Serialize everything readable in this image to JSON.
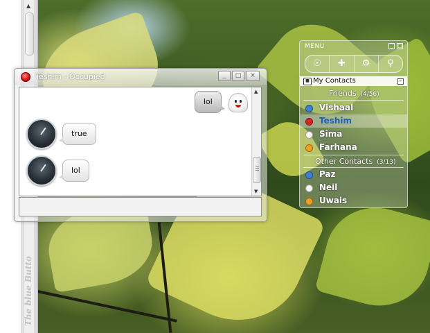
{
  "left_panel": {
    "vertical_text": "The blue Butto"
  },
  "chat": {
    "title": "Teshim - Occupied",
    "window_buttons": {
      "minimize": "_",
      "maximize": "□",
      "close": "×"
    },
    "messages": [
      {
        "from": "me",
        "text": "lol"
      },
      {
        "from": "contact",
        "text": "true"
      },
      {
        "from": "contact",
        "text": "lol"
      }
    ],
    "input_value": ""
  },
  "contacts": {
    "menu_label": "MENU",
    "panel_buttons": {
      "minimize": "_",
      "close": "□"
    },
    "toolbar": [
      "contacts-icon",
      "plugin-icon",
      "settings-icon",
      "search-icon"
    ],
    "section_title": "My Contacts",
    "groups": [
      {
        "name": "Friends",
        "count": "(4/56)",
        "contacts": [
          {
            "name": "Vishaal",
            "status_color": "#3f7fd6",
            "selected": false
          },
          {
            "name": "Teshim",
            "status_color": "#d32727",
            "selected": true
          },
          {
            "name": "Sima",
            "status_color": "#f4f4f4",
            "selected": false
          },
          {
            "name": "Farhana",
            "status_color": "#f0a020",
            "selected": false
          }
        ]
      },
      {
        "name": "Other Contacts",
        "count": "(3/13)",
        "contacts": [
          {
            "name": "Paz",
            "status_color": "#3f7fd6",
            "selected": false
          },
          {
            "name": "Neil",
            "status_color": "#f4f4f4",
            "selected": false
          },
          {
            "name": "Uwais",
            "status_color": "#f0a020",
            "selected": false
          }
        ]
      }
    ]
  }
}
